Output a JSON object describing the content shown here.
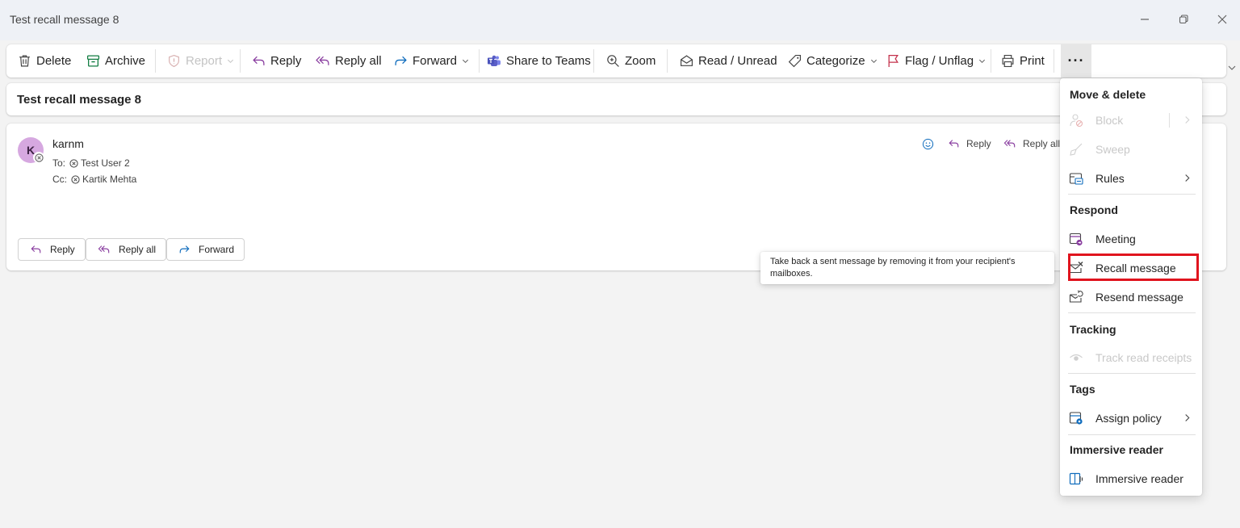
{
  "window": {
    "title": "Test recall message 8"
  },
  "toolbar": {
    "delete": "Delete",
    "archive": "Archive",
    "report": "Report",
    "reply": "Reply",
    "reply_all": "Reply all",
    "forward": "Forward",
    "share_to_teams": "Share to Teams",
    "zoom": "Zoom",
    "read_unread": "Read / Unread",
    "categorize": "Categorize",
    "flag_unflag": "Flag / Unflag",
    "print": "Print",
    "more": "···"
  },
  "subject": "Test recall message 8",
  "message": {
    "avatar_initial": "K",
    "sender": "karnm",
    "to_label": "To:",
    "to_name": "Test User 2",
    "cc_label": "Cc:",
    "cc_name": "Kartik Mehta",
    "header_actions": {
      "reply": "Reply",
      "reply_all": "Reply all"
    },
    "footer_buttons": {
      "reply": "Reply",
      "reply_all": "Reply all",
      "forward": "Forward"
    }
  },
  "tooltip": "Take back a sent message by removing it from your recipient's mailboxes.",
  "menu": {
    "sections": {
      "move_delete": "Move & delete",
      "respond": "Respond",
      "tracking": "Tracking",
      "tags": "Tags",
      "immersive_reader": "Immersive reader"
    },
    "items": {
      "block": "Block",
      "sweep": "Sweep",
      "rules": "Rules",
      "meeting": "Meeting",
      "recall": "Recall message",
      "resend": "Resend message",
      "track_read_receipts": "Track read receipts",
      "assign_policy": "Assign policy",
      "immersive_reader": "Immersive reader"
    }
  },
  "colors": {
    "accent_purple": "#8a3fa0",
    "teams_purple": "#5b5fc7",
    "flag_red": "#c4314b",
    "highlight_red": "#e0141e",
    "avatar_bg": "#d6a8e0",
    "icon_blue": "#0f6cbd"
  },
  "icons": [
    "trash-icon",
    "archive-icon",
    "shield-report-icon",
    "reply-icon",
    "reply-all-icon",
    "forward-icon",
    "teams-icon",
    "zoom-icon",
    "envelope-icon",
    "tag-icon",
    "flag-icon",
    "printer-icon",
    "more-icon",
    "block-icon",
    "sweep-icon",
    "rules-icon",
    "meeting-icon",
    "recall-icon",
    "resend-icon",
    "eye-icon",
    "policy-icon",
    "immersive-reader-icon",
    "emoji-icon",
    "chevron-down-icon",
    "chevron-right-icon"
  ]
}
